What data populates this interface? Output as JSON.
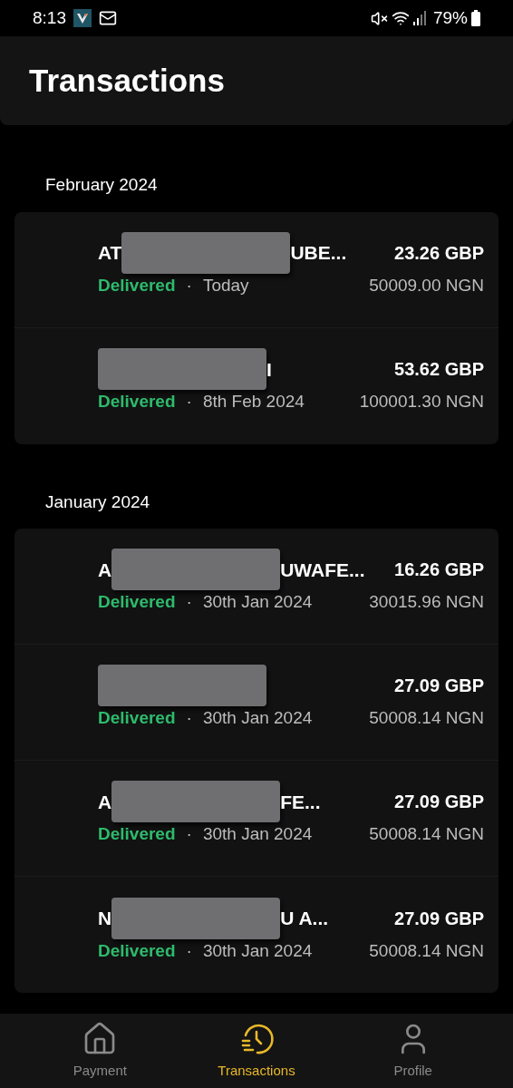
{
  "status_bar": {
    "time": "8:13",
    "battery": "79%"
  },
  "header": {
    "title": "Transactions"
  },
  "sections": [
    {
      "label": "February 2024",
      "transactions": [
        {
          "name_start": "AT",
          "name_end": "UBE...",
          "redacted": true,
          "status": "Delivered",
          "separator": "·",
          "date": "Today",
          "amount": "23.26 GBP",
          "converted": "50009.00 NGN"
        },
        {
          "name_end": "I",
          "redacted": true,
          "status": "Delivered",
          "separator": "·",
          "date": "8th Feb 2024",
          "amount": "53.62 GBP",
          "converted": "100001.30 NGN"
        }
      ]
    },
    {
      "label": "January 2024",
      "transactions": [
        {
          "name_start": "A",
          "name_end": "UWAFE...",
          "redacted": true,
          "status": "Delivered",
          "separator": "·",
          "date": "30th Jan 2024",
          "amount": "16.26 GBP",
          "converted": "30015.96 NGN"
        },
        {
          "redacted": true,
          "status": "Delivered",
          "separator": "·",
          "date": "30th Jan 2024",
          "amount": "27.09 GBP",
          "converted": "50008.14 NGN"
        },
        {
          "name_start": "A",
          "name_end": "FE...",
          "redacted": true,
          "status": "Delivered",
          "separator": "·",
          "date": "30th Jan 2024",
          "amount": "27.09 GBP",
          "converted": "50008.14 NGN"
        },
        {
          "name_start": "N",
          "name_end": "U A...",
          "redacted": true,
          "status": "Delivered",
          "separator": "·",
          "date": "30th Jan 2024",
          "amount": "27.09 GBP",
          "converted": "50008.14 NGN"
        }
      ]
    }
  ],
  "nav": [
    {
      "kind": "home",
      "label": "Payment",
      "selected": false
    },
    {
      "kind": "history",
      "label": "Transactions",
      "selected": true
    },
    {
      "kind": "profile",
      "label": "Profile",
      "selected": false
    }
  ]
}
